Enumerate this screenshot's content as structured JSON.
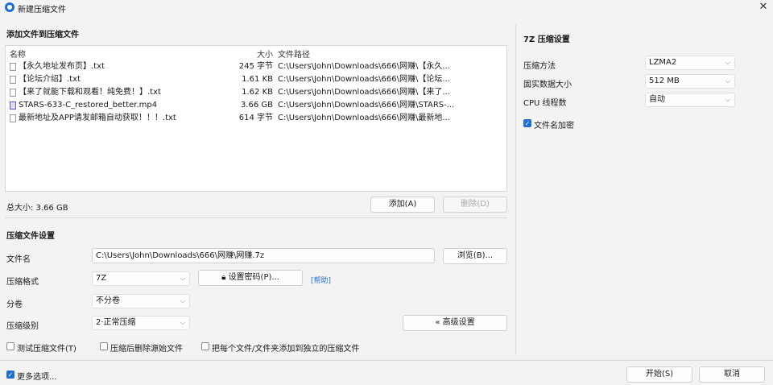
{
  "window": {
    "title": "新建压缩文件",
    "close_glyph": "✕"
  },
  "add_section": {
    "title": "添加文件到压缩文件"
  },
  "file_list": {
    "headers": {
      "name": "名称",
      "size": "大小",
      "path": "文件路径"
    },
    "rows": [
      {
        "name": "【永久地址发布页】.txt",
        "size": "245 字节",
        "path": "C:\\Users\\John\\Downloads\\666\\网赚\\【永久...",
        "icon": "text-file-icon"
      },
      {
        "name": "【论坛介绍】.txt",
        "size": "1.61 KB",
        "path": "C:\\Users\\John\\Downloads\\666\\网赚\\【论坛...",
        "icon": "text-file-icon"
      },
      {
        "name": "【来了就能下载和观看！纯免费！】.txt",
        "size": "1.62 KB",
        "path": "C:\\Users\\John\\Downloads\\666\\网赚\\【来了...",
        "icon": "text-file-icon"
      },
      {
        "name": "STARS-633-C_restored_better.mp4",
        "size": "3.66 GB",
        "path": "C:\\Users\\John\\Downloads\\666\\网赚\\STARS-...",
        "icon": "video-file-icon"
      },
      {
        "name": "最新地址及APP请发邮箱自动获取！！！.txt",
        "size": "614 字节",
        "path": "C:\\Users\\John\\Downloads\\666\\网赚\\最新地...",
        "icon": "text-file-icon"
      }
    ]
  },
  "total_size": "总大小: 3.66 GB",
  "buttons": {
    "add": "添加(A)",
    "delete": "删除(D)",
    "browse": "浏览(B)...",
    "set_password": "设置密码(P)...",
    "help": "[帮助]",
    "advanced": "« 高级设置",
    "start": "开始(S)",
    "cancel": "取消"
  },
  "compress_settings": {
    "title": "压缩文件设置",
    "filename_label": "文件名",
    "filename_value": "C:\\Users\\John\\Downloads\\666\\网赚\\网赚.7z",
    "format_label": "压缩格式",
    "format_value": "7Z",
    "split_label": "分卷",
    "split_value": "不分卷",
    "level_label": "压缩级别",
    "level_value": "2·正常压缩"
  },
  "options": {
    "test": "测试压缩文件(T)",
    "delete_after": "压缩后删除源始文件",
    "separate": "把每个文件/文件夹添加到独立的压缩文件",
    "more": "更多选项..."
  },
  "sevenz": {
    "title": "7Z 压缩设置",
    "method_label": "压缩方法",
    "method_value": "LZMA2",
    "dict_label": "固实数据大小",
    "dict_value": "512 MB",
    "cpu_label": "CPU 线程数",
    "cpu_value": "自动",
    "encrypt_label": "文件名加密"
  },
  "colors": {
    "accent": "#1f6fd1"
  }
}
